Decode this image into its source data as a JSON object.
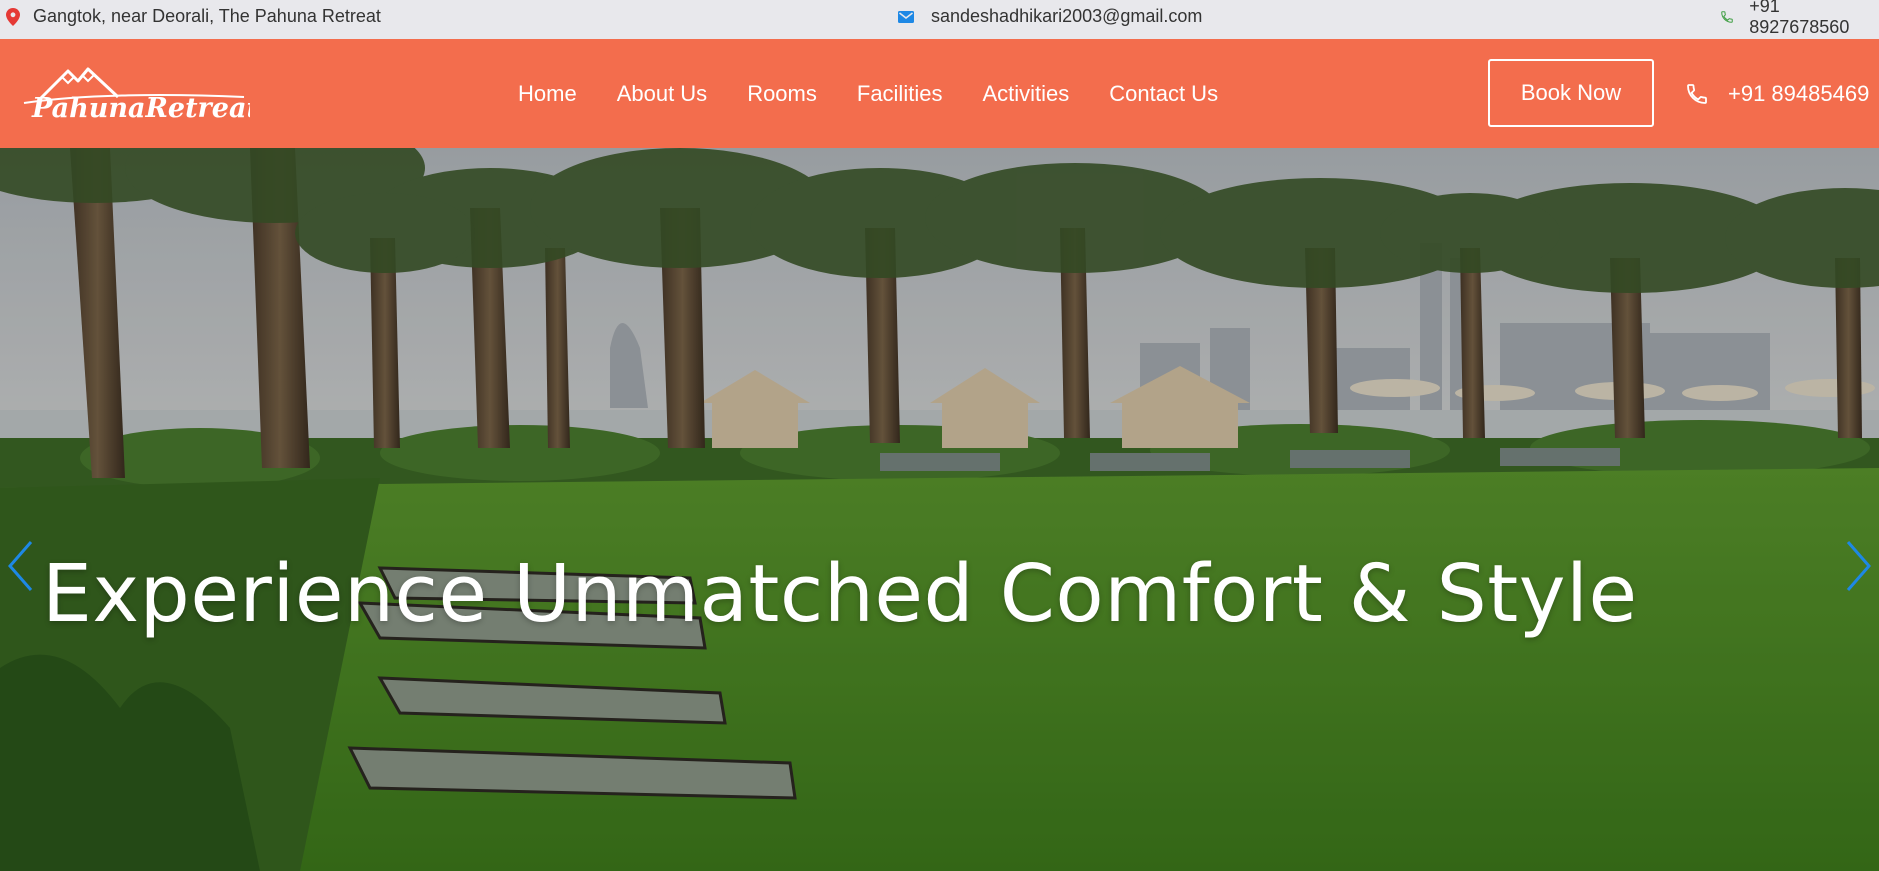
{
  "topbar": {
    "location": "Gangtok, near Deorali, The Pahuna Retreat",
    "email": "sandeshadhikari2003@gmail.com",
    "phone": "+91 8927678560",
    "icons": {
      "location": "map-pin-icon",
      "email": "envelope-icon",
      "phone": "phone-icon"
    }
  },
  "brand": {
    "logo_text": "PahunaRetreat"
  },
  "nav": {
    "links": [
      {
        "label": "Home"
      },
      {
        "label": "About Us"
      },
      {
        "label": "Rooms"
      },
      {
        "label": "Facilities"
      },
      {
        "label": "Activities"
      },
      {
        "label": "Contact Us"
      }
    ],
    "book_label": "Book Now",
    "phone": "+91 89485469"
  },
  "hero": {
    "title": "Experience Unmatched Comfort & Style",
    "prev_icon": "chevron-left-icon",
    "next_icon": "chevron-right-icon"
  },
  "colors": {
    "nav_bg": "#f36d4d",
    "topbar_bg": "#e8e8ec",
    "location_icon": "#e53935",
    "email_icon": "#1e88e5",
    "phone_icon": "#43a047",
    "arrow": "#1e88e5"
  }
}
